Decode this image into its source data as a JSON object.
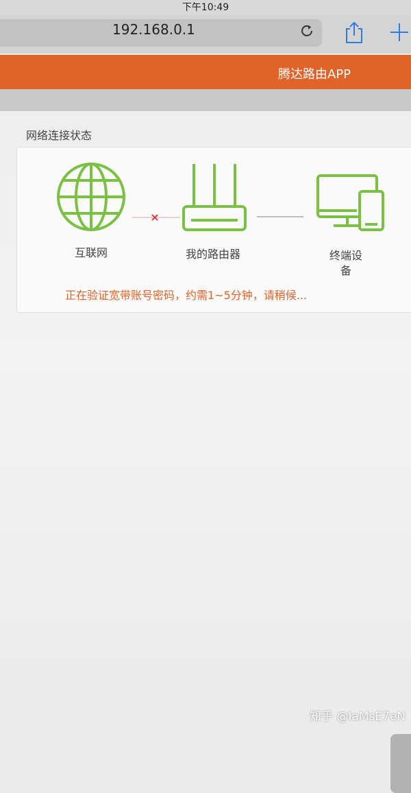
{
  "status_bar": {
    "time": "下午10:49"
  },
  "browser": {
    "url": "192.168.0.1"
  },
  "header": {
    "app_title": "腾达路由APP"
  },
  "network_status": {
    "title": "网络连接状态",
    "nodes": {
      "internet": "互联网",
      "router": "我的路由器",
      "terminal_line1": "终端设",
      "terminal_line2": "备"
    },
    "message": "正在验证宽带账号密码，约需1~5分钟，请稍候..."
  },
  "colors": {
    "accent": "#e0632a",
    "device_green": "#7ac143",
    "link_red": "#e04040"
  },
  "watermark": "知乎 @IaMsE7eN"
}
